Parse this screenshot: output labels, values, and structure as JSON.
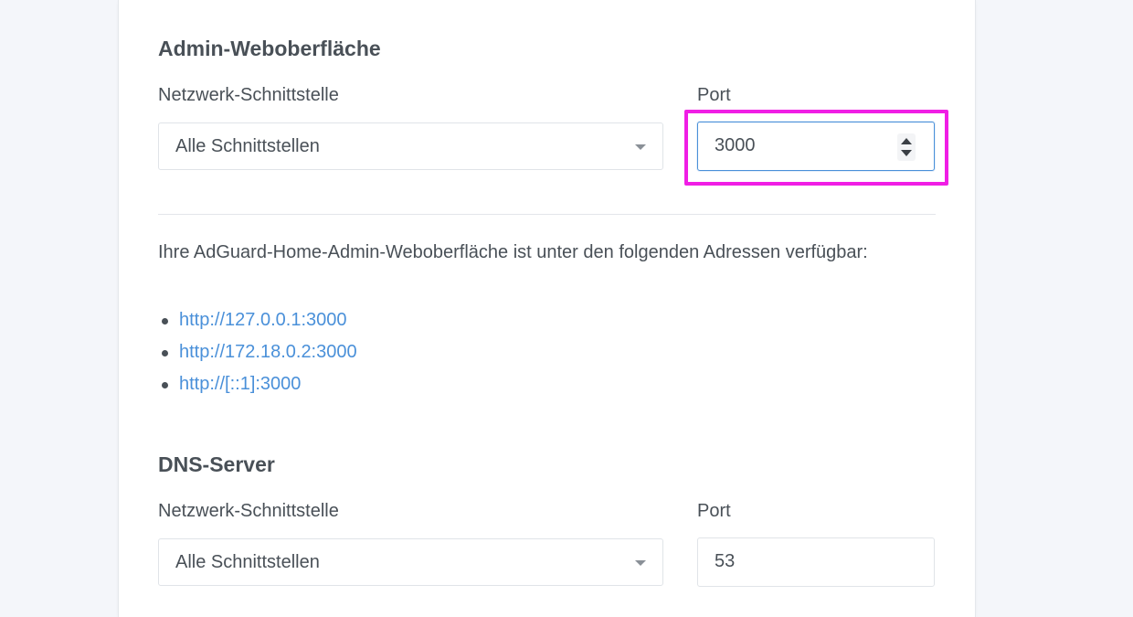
{
  "admin": {
    "title": "Admin-Weboberfläche",
    "interface_label": "Netzwerk-Schnittstelle",
    "interface_value": "Alle Schnittstellen",
    "port_label": "Port",
    "port_value": "3000",
    "info_text": "Ihre AdGuard-Home-Admin-Weboberfläche ist unter den folgenden Adressen verfügbar:",
    "addresses": [
      "http://127.0.0.1:3000",
      "http://172.18.0.2:3000",
      "http://[::1]:3000"
    ]
  },
  "dns": {
    "title": "DNS-Server",
    "interface_label": "Netzwerk-Schnittstelle",
    "interface_value": "Alle Schnittstellen",
    "port_label": "Port",
    "port_value": "53"
  },
  "colors": {
    "link": "#4a90d9",
    "highlight": "#f01ee5",
    "focus_border": "#4a90d9"
  }
}
